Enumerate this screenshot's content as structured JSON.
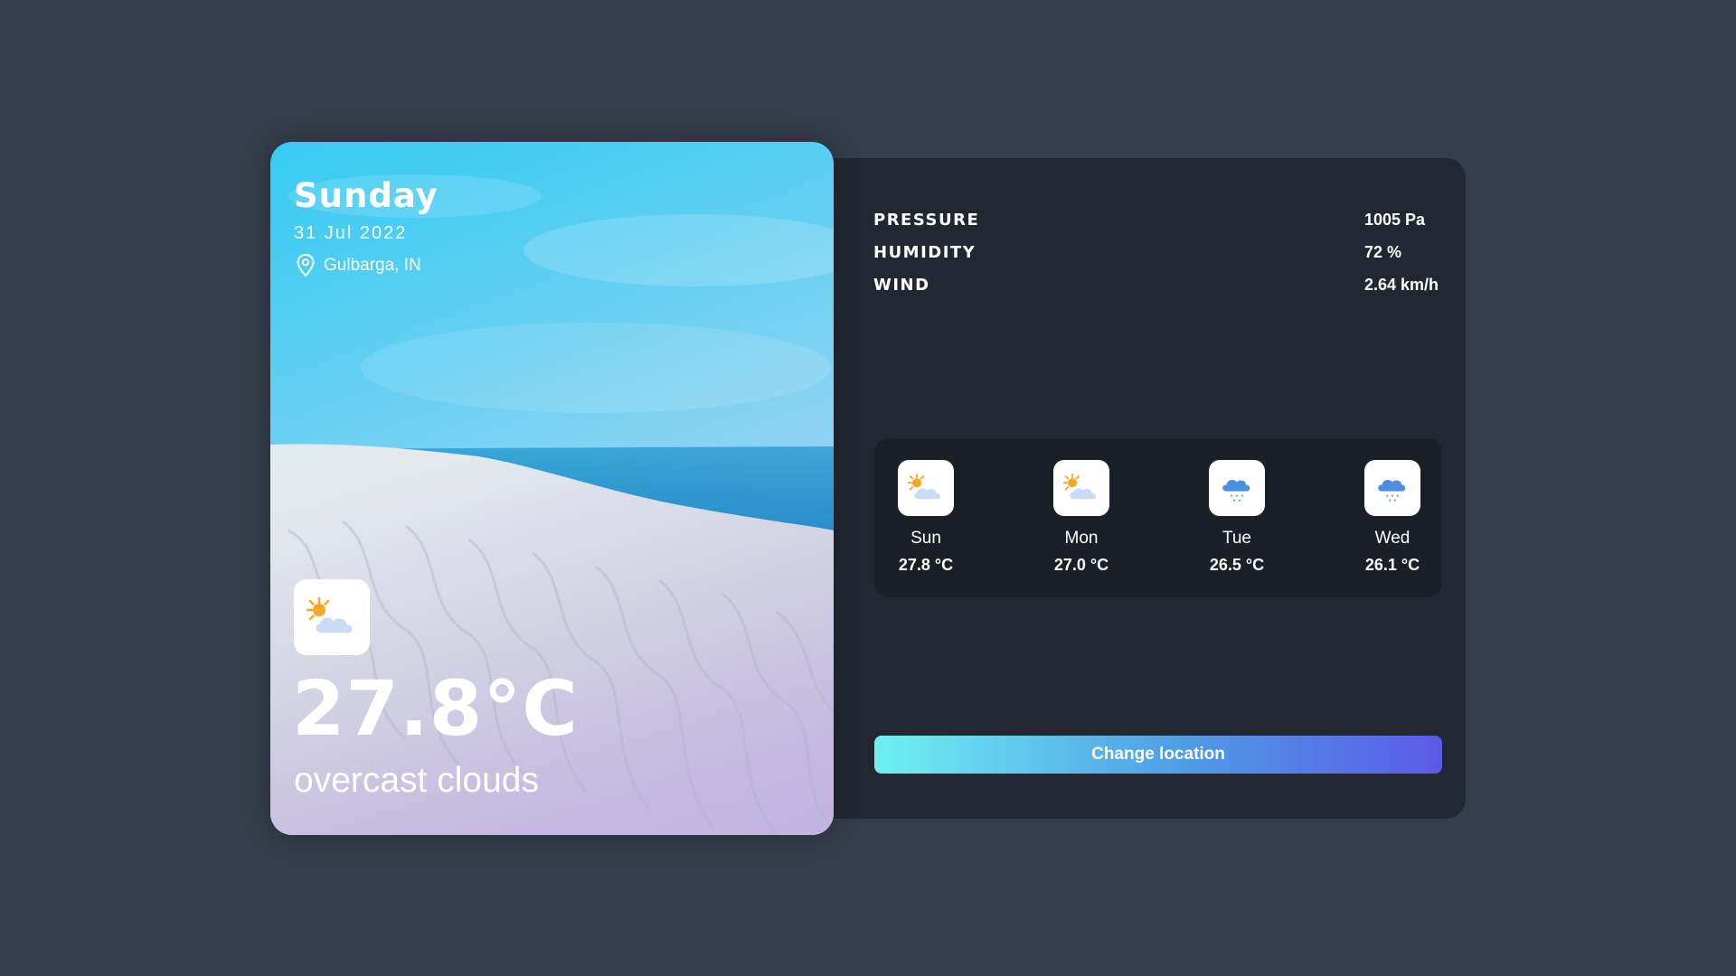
{
  "hero": {
    "day": "Sunday",
    "date": "31 Jul 2022",
    "location": "Gulbarga, IN",
    "icon": "partly-cloudy-icon",
    "temperature": "27.8°C",
    "description": "overcast clouds"
  },
  "stats": [
    {
      "label": "PRESSURE",
      "value": "1005 Pa"
    },
    {
      "label": "HUMIDITY",
      "value": "72 %"
    },
    {
      "label": "WIND",
      "value": "2.64 km/h"
    }
  ],
  "forecast": [
    {
      "day": "Sun",
      "temp": "27.8 °C",
      "icon": "partly-cloudy-icon"
    },
    {
      "day": "Mon",
      "temp": "27.0 °C",
      "icon": "partly-cloudy-icon"
    },
    {
      "day": "Tue",
      "temp": "26.5 °C",
      "icon": "rain-cloud-icon"
    },
    {
      "day": "Wed",
      "temp": "26.1 °C",
      "icon": "rain-cloud-icon"
    }
  ],
  "actions": {
    "change_location": "Change location"
  },
  "colors": {
    "page_bg": "#343d4b",
    "panel_bg": "#222831",
    "forecast_bg": "#1b2028",
    "button_gradient_start": "#6ff0f2",
    "button_gradient_end": "#5b5ae8"
  }
}
